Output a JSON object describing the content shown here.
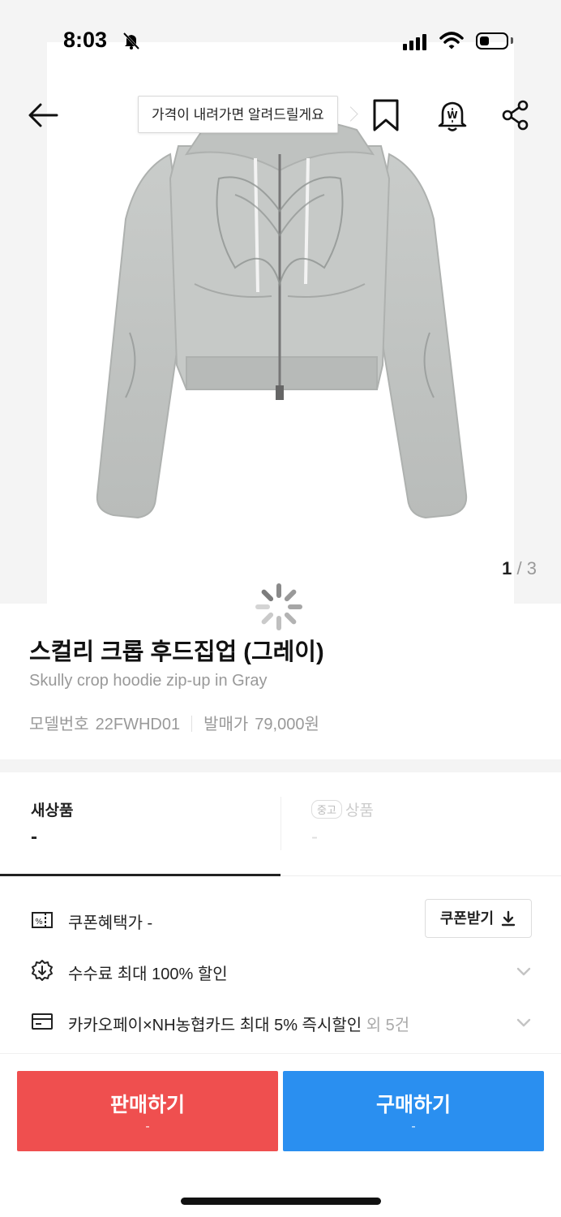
{
  "status_bar": {
    "time": "8:03"
  },
  "hero": {
    "tooltip": "가격이 내려가면 알려드릴게요",
    "pager_current": "1",
    "pager_sep": " / ",
    "pager_total": "3"
  },
  "product": {
    "title": "스컬리 크롭 후드집업 (그레이)",
    "subtitle": "Skully crop hoodie zip-up in Gray",
    "model_label": "모델번호",
    "model_value": "22FWHD01",
    "release_label": "발매가",
    "release_value": "79,000원"
  },
  "tabs": [
    {
      "label": "새상품",
      "price": "-",
      "active": true
    },
    {
      "badge": "중고",
      "label": "상품",
      "price": "-",
      "active": false
    }
  ],
  "benefits": {
    "coupon_label": "쿠폰혜택가 -",
    "coupon_button": "쿠폰받기",
    "fee_label": "수수료 최대 100% 할인",
    "card_label": "카카오페이×NH농협카드 최대 5% 즉시할인",
    "card_extra": " 외 5건"
  },
  "actions": {
    "sell_label": "판매하기",
    "sell_price": "-",
    "buy_label": "구매하기",
    "buy_price": "-"
  },
  "colors": {
    "sell": "#ef4f4f",
    "buy": "#2a8ff0"
  },
  "icons": [
    "bell-slash-icon",
    "signal-icon",
    "wifi-icon",
    "battery-icon",
    "back-arrow-icon",
    "bookmark-icon",
    "price-alarm-icon",
    "share-icon",
    "loading-spinner-icon",
    "coupon-icon",
    "fee-discount-icon",
    "card-icon",
    "chevron-down-icon",
    "download-icon"
  ]
}
